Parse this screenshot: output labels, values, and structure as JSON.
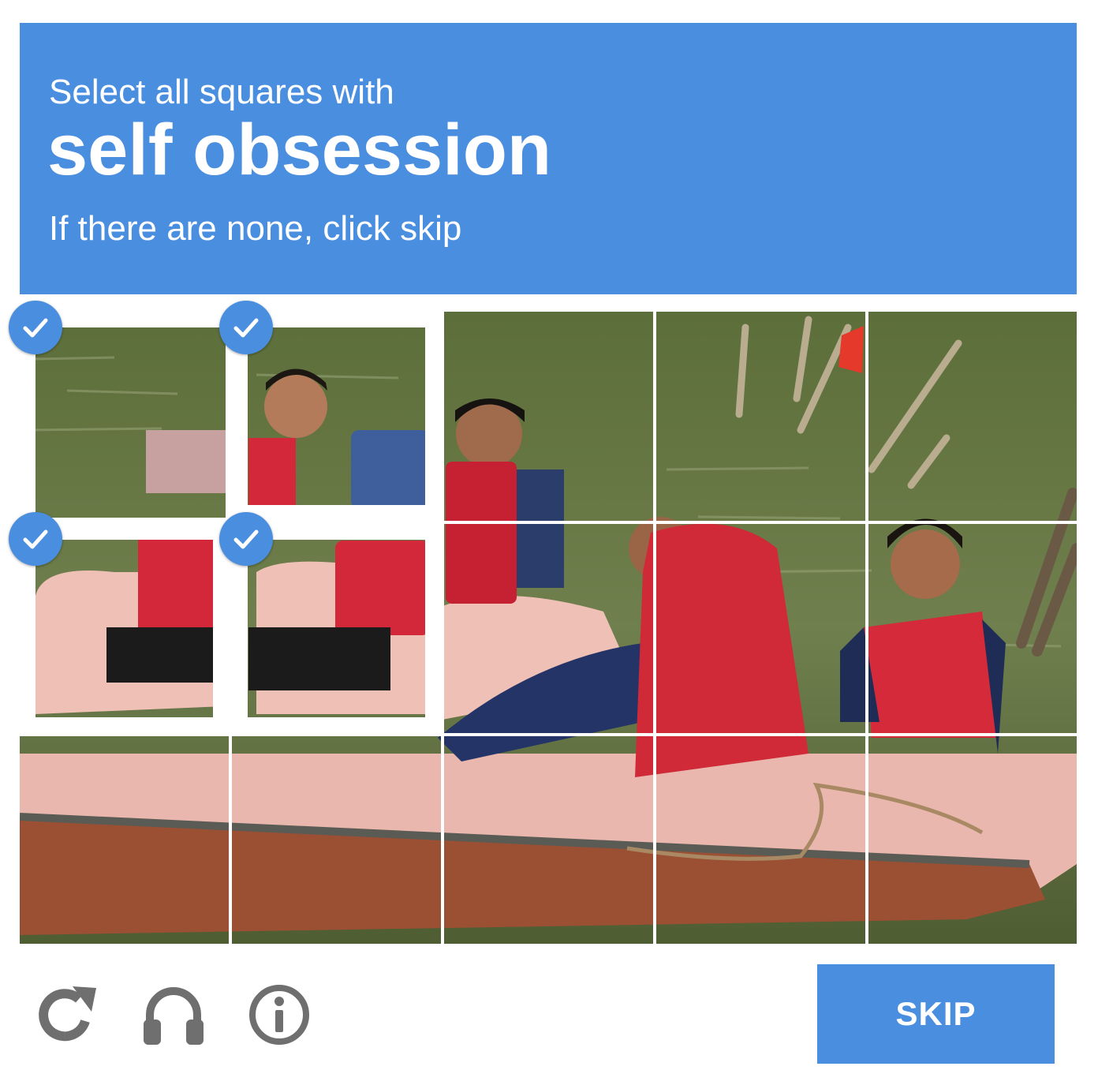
{
  "header": {
    "instruction": "Select all squares with",
    "target": "self obsession",
    "hint": "If there are none, click skip"
  },
  "grid": {
    "rows": 3,
    "cols": 5,
    "selected_tiles": [
      {
        "row": 0,
        "col": 0
      },
      {
        "row": 0,
        "col": 1
      },
      {
        "row": 1,
        "col": 0
      },
      {
        "row": 1,
        "col": 1
      }
    ]
  },
  "footer": {
    "icons": [
      "reload-icon",
      "headphones-icon",
      "info-icon"
    ],
    "skip_label": "SKIP"
  },
  "colors": {
    "accent": "#4a8ee0",
    "icon_gray": "#6f6f6f"
  }
}
